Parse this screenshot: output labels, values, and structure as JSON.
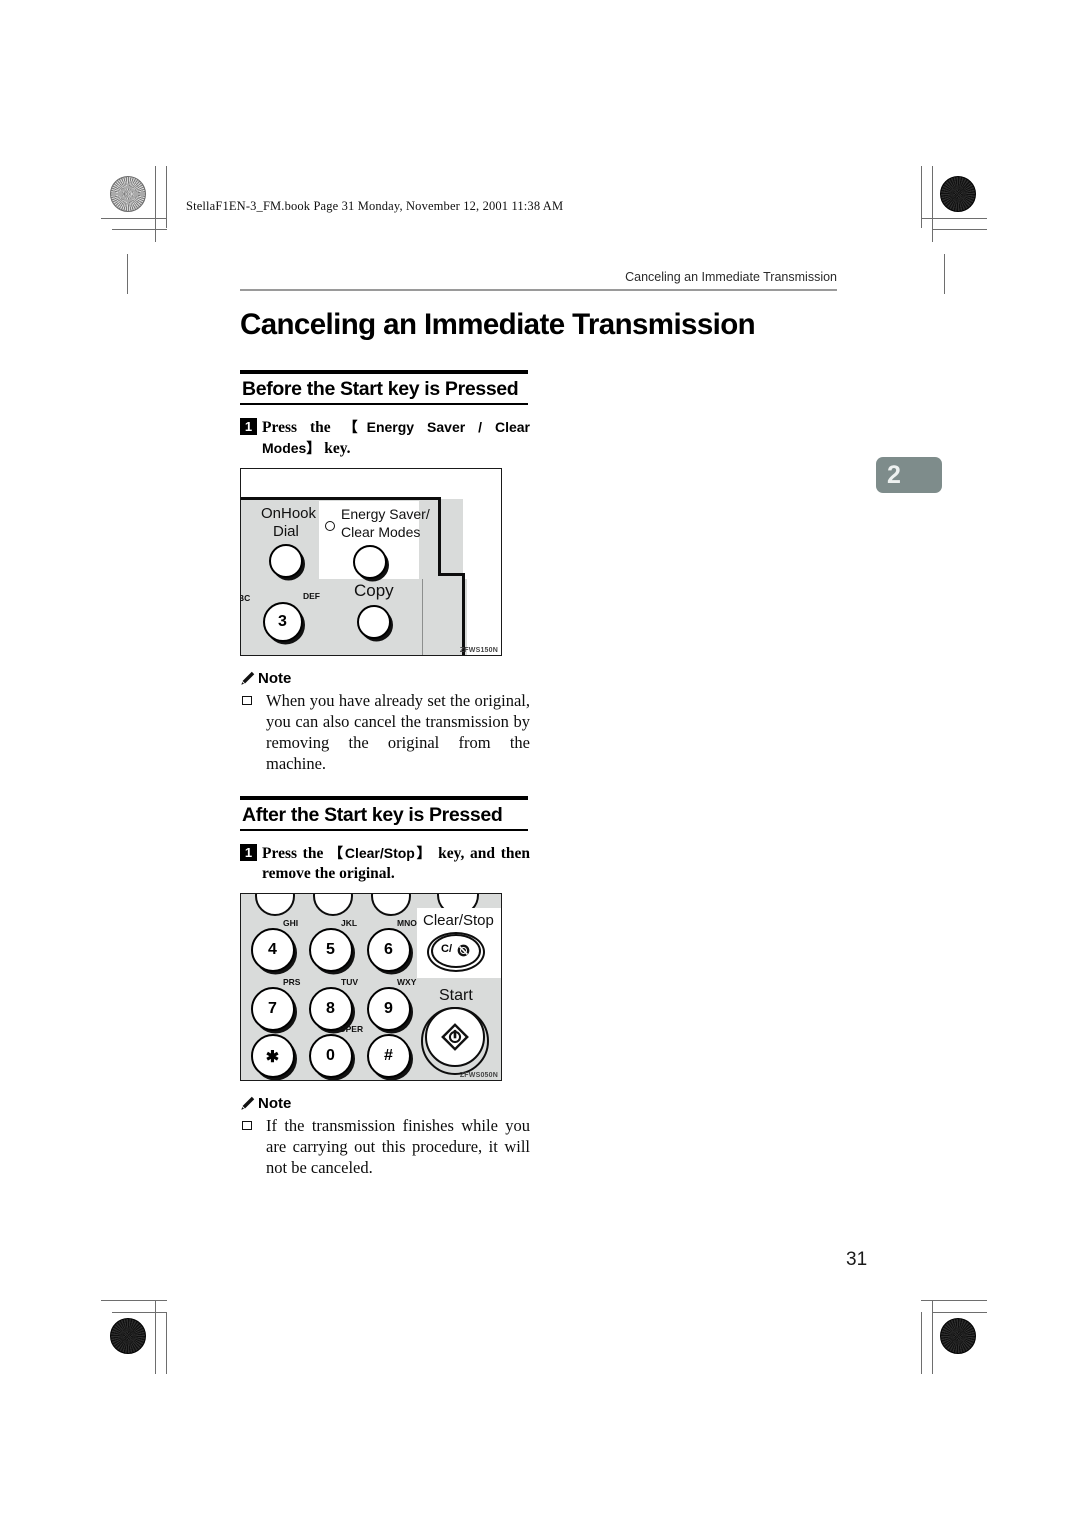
{
  "file_header": "StellaF1EN-3_FM.book  Page 31  Monday, November 12, 2001  11:38 AM",
  "running_header": "Canceling an Immediate Transmission",
  "chapter_tab": "2",
  "page_number": "31",
  "doc_title": "Canceling an Immediate Transmission",
  "sections": [
    {
      "heading": "Before the Start key is Pressed",
      "step": {
        "number": "1",
        "text_before": "Press  the  ",
        "keycap": "【Energy Saver / Clear Modes】",
        "text_after": " key."
      },
      "figure": {
        "id": "ZFWS150N",
        "labels": {
          "onhook_line1": "OnHook",
          "onhook_line2": "Dial",
          "energy_line1": "Energy Saver/",
          "energy_line2": "Clear Modes",
          "copy": "Copy",
          "key3_num": "3",
          "key3_sub": "DEF",
          "key2_sub": "BC"
        }
      },
      "note": {
        "title": "Note",
        "items": [
          "When you have already set the original, you can also cancel the transmission by removing the original from the machine."
        ]
      }
    },
    {
      "heading": "After the Start key is Pressed",
      "step": {
        "number": "1",
        "text_before": "Press  the  ",
        "keycap": "【Clear/Stop】",
        "text_after": "  key,  and then remove the original."
      },
      "figure": {
        "id": "ZFWS050N",
        "labels": {
          "clear_stop": "Clear/Stop",
          "clear_stop_glyph": "C/",
          "start": "Start"
        },
        "keypad": [
          {
            "num": "4",
            "sub": "GHI"
          },
          {
            "num": "5",
            "sub": "JKL"
          },
          {
            "num": "6",
            "sub": "MNO"
          },
          {
            "num": "7",
            "sub": "PRS"
          },
          {
            "num": "8",
            "sub": "TUV"
          },
          {
            "num": "9",
            "sub": "WXY"
          },
          {
            "num": "✱",
            "sub": ""
          },
          {
            "num": "0",
            "sub": "OPER"
          },
          {
            "num": "#",
            "sub": ""
          }
        ]
      },
      "note": {
        "title": "Note",
        "items": [
          "If the transmission finishes while you are carrying out this procedure, it will not be canceled."
        ]
      }
    }
  ]
}
